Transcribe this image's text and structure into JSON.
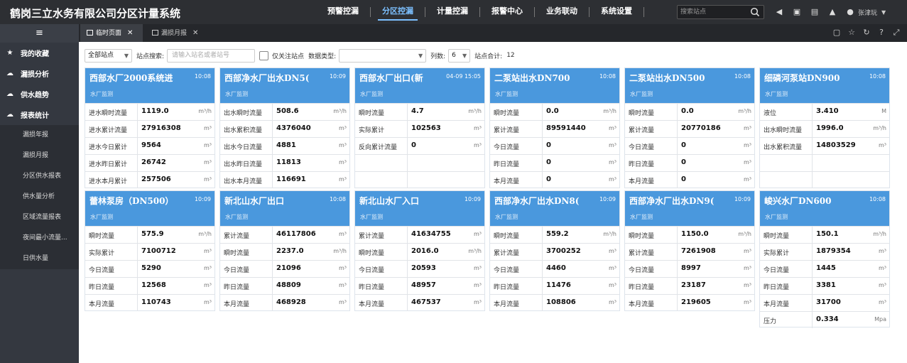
{
  "header": {
    "title": "鹤岗三立水务有限公司分区计量系统",
    "nav": [
      "预警控漏",
      "分区控漏",
      "计量控漏",
      "报警中心",
      "业务联动",
      "系统设置"
    ],
    "active_nav": 1,
    "search_placeholder": "搜索站点",
    "user": "张津玩"
  },
  "sidebar": {
    "items": [
      {
        "label": "我的收藏",
        "icon": "star-icon"
      },
      {
        "label": "漏损分析",
        "icon": "cloud-icon"
      },
      {
        "label": "供水趋势",
        "icon": "cloud-icon"
      },
      {
        "label": "报表统计",
        "icon": "cloud-icon"
      }
    ],
    "subitems": [
      "漏损年报",
      "漏损月报",
      "分区供水报表",
      "供水量分析",
      "区域流量报表",
      "夜间最小流量...",
      "日供水量"
    ]
  },
  "tabs": [
    {
      "label": "临时页面",
      "active": true
    },
    {
      "label": "漏损月报",
      "active": false
    }
  ],
  "filters": {
    "station_select": "全部站点",
    "search_label": "站点搜索:",
    "search_placeholder": "请输入站名或者站号",
    "only_follow": "仅关注站点",
    "type_label": "数据类型:",
    "type_value": "",
    "cols_label": "列数:",
    "cols_value": "6",
    "total_label": "站点合计:",
    "total_value": "12"
  },
  "cards": [
    {
      "title": "西部水厂2000系统进",
      "time": "10:08",
      "sub": "水厂监测",
      "rows": [
        {
          "k": "进水瞬时流量",
          "v": "1119.0",
          "u": "m³/h"
        },
        {
          "k": "进水累计流量",
          "v": "27916308",
          "u": "m³"
        },
        {
          "k": "进水今日累计",
          "v": "9564",
          "u": "m³"
        },
        {
          "k": "进水昨日累计",
          "v": "26742",
          "u": "m³"
        },
        {
          "k": "进水本月累计",
          "v": "257506",
          "u": "m³"
        }
      ]
    },
    {
      "title": "西部净水厂出水DN5(",
      "time": "10:09",
      "sub": "水厂监测",
      "rows": [
        {
          "k": "出水瞬时流量",
          "v": "508.6",
          "u": "m³/h"
        },
        {
          "k": "出水累积流量",
          "v": "4376040",
          "u": "m³"
        },
        {
          "k": "出水今日流量",
          "v": "4881",
          "u": "m³"
        },
        {
          "k": "出水昨日流量",
          "v": "11813",
          "u": "m³"
        },
        {
          "k": "出水本月流量",
          "v": "116691",
          "u": "m³"
        }
      ]
    },
    {
      "title": "西部水厂出口(新",
      "time": "04-09 15:05",
      "sub": "水厂监测",
      "rows": [
        {
          "k": "瞬时流量",
          "v": "4.7",
          "u": "m³/h"
        },
        {
          "k": "实际累计",
          "v": "102563",
          "u": "m³"
        },
        {
          "k": "反向累计流量",
          "v": "0",
          "u": "m³"
        },
        {
          "k": "",
          "v": "",
          "u": ""
        },
        {
          "k": "",
          "v": "",
          "u": ""
        }
      ]
    },
    {
      "title": "二泵站出水DN700",
      "time": "10:08",
      "sub": "水厂监测",
      "rows": [
        {
          "k": "瞬时流量",
          "v": "0.0",
          "u": "m³/h"
        },
        {
          "k": "累计流量",
          "v": "89591440",
          "u": "m³"
        },
        {
          "k": "今日流量",
          "v": "0",
          "u": "m³"
        },
        {
          "k": "昨日流量",
          "v": "0",
          "u": "m³"
        },
        {
          "k": "本月流量",
          "v": "0",
          "u": "m³"
        }
      ]
    },
    {
      "title": "二泵站出水DN500",
      "time": "10:08",
      "sub": "水厂监测",
      "rows": [
        {
          "k": "瞬时流量",
          "v": "0.0",
          "u": "m³/h"
        },
        {
          "k": "累计流量",
          "v": "20770186",
          "u": "m³"
        },
        {
          "k": "今日流量",
          "v": "0",
          "u": "m³"
        },
        {
          "k": "昨日流量",
          "v": "0",
          "u": "m³"
        },
        {
          "k": "本月流量",
          "v": "0",
          "u": "m³"
        }
      ]
    },
    {
      "title": "细磷河泵站DN900",
      "time": "10:08",
      "sub": "水厂监测",
      "rows": [
        {
          "k": "液位",
          "v": "3.410",
          "u": "M"
        },
        {
          "k": "出水瞬时流量",
          "v": "1996.0",
          "u": "m³/h"
        },
        {
          "k": "出水累积流量",
          "v": "14803529",
          "u": "m³"
        },
        {
          "k": "",
          "v": "",
          "u": ""
        },
        {
          "k": "",
          "v": "",
          "u": ""
        }
      ]
    },
    {
      "title": "蕾林泵房（DN500）",
      "time": "10:09",
      "sub": "水厂监测",
      "rows": [
        {
          "k": "瞬时流量",
          "v": "575.9",
          "u": "m³/h"
        },
        {
          "k": "实际累计",
          "v": "7100712",
          "u": "m³"
        },
        {
          "k": "今日流量",
          "v": "5290",
          "u": "m³"
        },
        {
          "k": "昨日流量",
          "v": "12568",
          "u": "m³"
        },
        {
          "k": "本月流量",
          "v": "110743",
          "u": "m³"
        }
      ]
    },
    {
      "title": "新北山水厂出口",
      "time": "10:08",
      "sub": "水厂监测",
      "rows": [
        {
          "k": "累计流量",
          "v": "46117806",
          "u": "m³"
        },
        {
          "k": "瞬时流量",
          "v": "2237.0",
          "u": "m³/h"
        },
        {
          "k": "今日流量",
          "v": "21096",
          "u": "m³"
        },
        {
          "k": "昨日流量",
          "v": "48809",
          "u": "m³"
        },
        {
          "k": "本月流量",
          "v": "468928",
          "u": "m³"
        }
      ]
    },
    {
      "title": "新北山水厂入口",
      "time": "10:09",
      "sub": "水厂监测",
      "rows": [
        {
          "k": "累计流量",
          "v": "41634755",
          "u": "m³"
        },
        {
          "k": "瞬时流量",
          "v": "2016.0",
          "u": "m³/h"
        },
        {
          "k": "今日流量",
          "v": "20593",
          "u": "m³"
        },
        {
          "k": "昨日流量",
          "v": "48957",
          "u": "m³"
        },
        {
          "k": "本月流量",
          "v": "467537",
          "u": "m³"
        }
      ]
    },
    {
      "title": "西部净水厂出水DN8(",
      "time": "10:09",
      "sub": "水厂监测",
      "rows": [
        {
          "k": "瞬时流量",
          "v": "559.2",
          "u": "m³/h"
        },
        {
          "k": "累计流量",
          "v": "3700252",
          "u": "m³"
        },
        {
          "k": "今日流量",
          "v": "4460",
          "u": "m³"
        },
        {
          "k": "昨日流量",
          "v": "11476",
          "u": "m³"
        },
        {
          "k": "本月流量",
          "v": "108806",
          "u": "m³"
        }
      ]
    },
    {
      "title": "西部净水厂出水DN9(",
      "time": "10:09",
      "sub": "水厂监测",
      "rows": [
        {
          "k": "瞬时流量",
          "v": "1150.0",
          "u": "m³/h"
        },
        {
          "k": "累计流量",
          "v": "7261908",
          "u": "m³"
        },
        {
          "k": "今日流量",
          "v": "8997",
          "u": "m³"
        },
        {
          "k": "昨日流量",
          "v": "23187",
          "u": "m³"
        },
        {
          "k": "本月流量",
          "v": "219605",
          "u": "m³"
        }
      ]
    },
    {
      "title": "峻兴水厂DN600",
      "time": "10:08",
      "sub": "水厂监测",
      "rows": [
        {
          "k": "瞬时流量",
          "v": "150.1",
          "u": "m³/h"
        },
        {
          "k": "实际累计",
          "v": "1879354",
          "u": "m³"
        },
        {
          "k": "今日流量",
          "v": "1445",
          "u": "m³"
        },
        {
          "k": "昨日流量",
          "v": "3381",
          "u": "m³"
        },
        {
          "k": "本月流量",
          "v": "31700",
          "u": "m³"
        },
        {
          "k": "压力",
          "v": "0.334",
          "u": "Mpa"
        }
      ]
    }
  ]
}
